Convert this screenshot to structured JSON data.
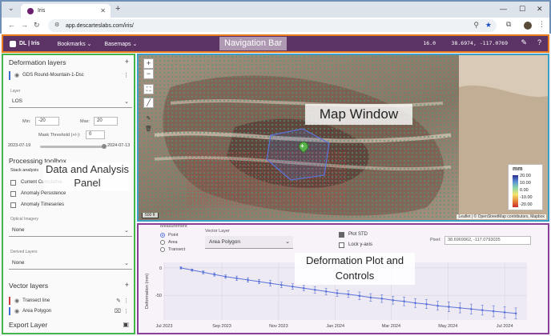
{
  "browser": {
    "tab_title": "Iris",
    "url": "app.descarteslabs.com/iris/"
  },
  "nav": {
    "logo": "DL | Iris",
    "bookmarks": "Bookmarks",
    "basemaps": "Basemaps",
    "zoom": "16.0",
    "coords": "38.6974, -117.0769",
    "annotation": "Navigation Bar"
  },
  "panel": {
    "deformation_layers": "Deformation layers",
    "layer_name": "GDS Round-Mountain-1-Dsc",
    "layer_label": "Layer",
    "layer_value": "LOS",
    "min_label": "Min:",
    "min_value": "-20",
    "max_label": "Max:",
    "max_value": "20",
    "mask_label": "Mask Threshold (+/-):",
    "mask_value": "0",
    "date_start": "2023-07-19",
    "date_end": "2024-07-13",
    "processing_toolbox": "Processing toolbox",
    "stack_analysis": "Stack analysis",
    "toolbox_items": [
      "Current Cumulative",
      "Anomaly Persistence",
      "Anomaly Timeseries"
    ],
    "optical_label": "Optical Imagery",
    "optical_value": "None",
    "derived_label": "Derived Layers",
    "derived_value": "None",
    "vector_layers": "Vector layers",
    "vector_items": [
      "Transect line",
      "Area Polygon"
    ],
    "export_layer": "Export Layer",
    "annotation": "Data and Analysis Panel"
  },
  "map": {
    "annotation": "Map Window",
    "legend_unit": "mm",
    "legend_ticks": [
      "20.00",
      "10.00",
      "0.00",
      "-10.00",
      "-20.00"
    ],
    "scale": "500 ft",
    "attribution": "Leaflet | © OpenStreetMap contributors, Mapbox"
  },
  "plot": {
    "measurement_label": "Measurement",
    "measurements": [
      "Point",
      "Area",
      "Transect"
    ],
    "vector_layer_label": "Vector Layer",
    "vector_layer_value": "Area Polygon",
    "plot_std": "Plot STD",
    "lock_y": "Lock y-axis",
    "pixel_label": "Pixel:",
    "pixel_value": "38.6969962, -117.0793035",
    "ylabel": "Deformation (mm)",
    "annotation": "Deformation Plot and Controls"
  },
  "chart_data": {
    "type": "line",
    "xlabel": "",
    "ylabel": "Deformation (mm)",
    "x_ticks": [
      "Jul 2023",
      "Sep 2023",
      "Nov 2023",
      "Jan 2024",
      "Mar 2024",
      "May 2024",
      "Jul 2024"
    ],
    "y_ticks": [
      0,
      -50
    ],
    "ylim": [
      -95,
      10
    ],
    "x": [
      "2023-07-19",
      "2023-07-31",
      "2023-08-12",
      "2023-08-24",
      "2023-09-05",
      "2023-09-17",
      "2023-09-29",
      "2023-10-11",
      "2023-10-23",
      "2023-11-04",
      "2023-11-16",
      "2023-11-28",
      "2023-12-10",
      "2023-12-22",
      "2024-01-03",
      "2024-01-15",
      "2024-01-27",
      "2024-02-08",
      "2024-02-20",
      "2024-03-03",
      "2024-03-15",
      "2024-03-27",
      "2024-04-08",
      "2024-04-20",
      "2024-05-02",
      "2024-05-14",
      "2024-05-26",
      "2024-06-07",
      "2024-06-19",
      "2024-07-01",
      "2024-07-13"
    ],
    "series": [
      {
        "values": [
          0,
          -4,
          -8,
          -12,
          -16,
          -19,
          -22,
          -25,
          -28,
          -31,
          -34,
          -37,
          -40,
          -43,
          -46,
          -48,
          -51,
          -54,
          -56,
          -59,
          -61,
          -64,
          -66,
          -69,
          -71,
          -73,
          -75,
          -77,
          -79,
          -81,
          -83
        ],
        "std": [
          2,
          2,
          3,
          3,
          3,
          4,
          4,
          4,
          5,
          5,
          5,
          5,
          6,
          6,
          6,
          6,
          7,
          7,
          7,
          7,
          8,
          8,
          8,
          8,
          9,
          9,
          9,
          9,
          10,
          10,
          10
        ]
      }
    ]
  }
}
